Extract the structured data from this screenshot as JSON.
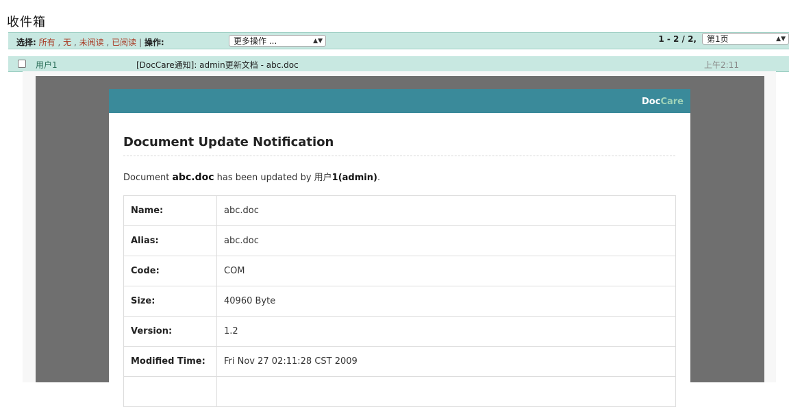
{
  "page": {
    "title": "收件箱"
  },
  "toolbar": {
    "select_label": "选择:",
    "select_all": "所有",
    "select_none": "无",
    "select_unread": "未阅读",
    "select_read": "已阅读",
    "comma": ",",
    "pipe": "|",
    "actions_label": "操作:",
    "actions_value": "更多操作 ...",
    "pager_text": "1 - 2 / 2,",
    "page_value": "第1页"
  },
  "email": {
    "sender": "用户1",
    "subject": "[DocCare通知]: admin更新文档 - abc.doc",
    "time": "上午2:11"
  },
  "notification": {
    "brand_part1": "Doc",
    "brand_part2": "Care",
    "title": "Document Update Notification",
    "desc_prefix": "Document ",
    "doc_name": "abc.doc",
    "desc_middle": " has been updated by ",
    "user_name": "用户",
    "user_suffix": "1(admin)",
    "desc_end": ".",
    "rows": [
      {
        "key": "Name:",
        "value": "abc.doc"
      },
      {
        "key": "Alias:",
        "value": "abc.doc"
      },
      {
        "key": "Code:",
        "value": "COM"
      },
      {
        "key": "Size:",
        "value": "40960 Byte"
      },
      {
        "key": "Version:",
        "value": "1.2"
      },
      {
        "key": "Modified Time:",
        "value": "Fri Nov 27 02:11:28 CST 2009"
      },
      {
        "key": "",
        "value": ""
      }
    ]
  },
  "colors": {
    "toolbar_bg": "#c8e8e1",
    "link": "#a83a24",
    "sender": "#2a6e58",
    "header_bar": "#3a8a9a",
    "preview_bg": "#6f6f6f"
  },
  "icons": {
    "select_arrows": "up-down-arrows-icon",
    "checkbox": "checkbox-icon"
  }
}
